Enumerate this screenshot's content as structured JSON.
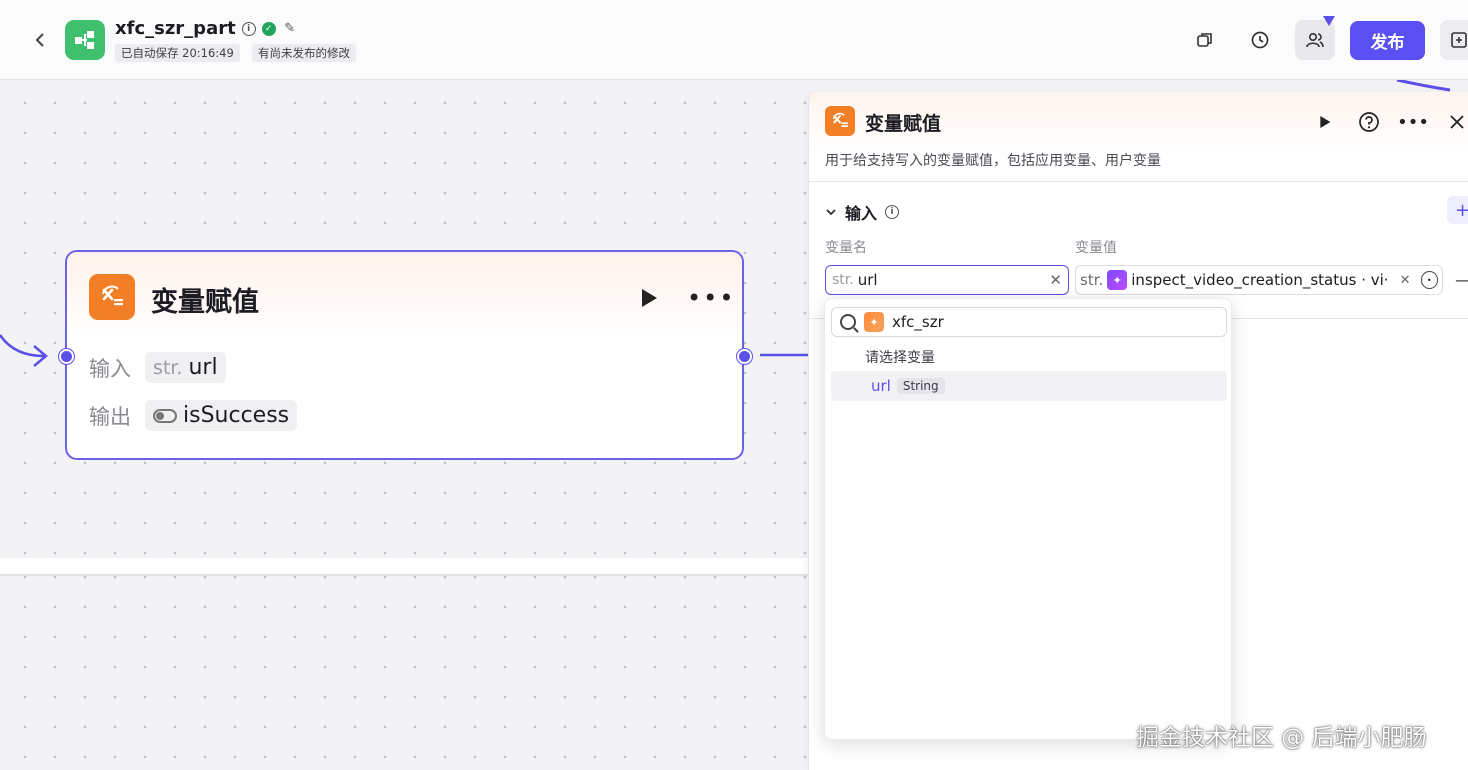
{
  "header": {
    "app_name": "xfc_szr_part",
    "autosave_tag": "已自动保存 20:16:49",
    "unpublished_tag": "有尚未发布的修改",
    "publish_label": "发布"
  },
  "node": {
    "title": "变量赋值",
    "input_label": "输入",
    "input_type": "str.",
    "input_value": "url",
    "output_label": "输出",
    "output_value": "isSuccess"
  },
  "panel": {
    "title": "变量赋值",
    "description": "用于给支持写入的变量赋值，包括应用变量、用户变量",
    "section_title": "输入",
    "col_name": "变量名",
    "col_value": "变量值",
    "name_type": "str.",
    "name_value": "url",
    "value_type": "str.",
    "value_text": "inspect_video_creation_status · vi···"
  },
  "dropdown": {
    "search_value": "xfc_szr",
    "label": "请选择变量",
    "items": [
      {
        "name": "url",
        "type": "String"
      }
    ]
  },
  "watermark": "掘金技术社区 @ 后端小肥肠",
  "colors": {
    "accent": "#5a4ff0",
    "node_icon": "#f27f25",
    "app_icon": "#3ec06e"
  },
  "icons": [
    "back-icon",
    "info-icon",
    "verified-icon",
    "edit-icon",
    "copy-icon",
    "history-icon",
    "users-icon",
    "run-icon",
    "help-icon",
    "more-icon",
    "close-icon",
    "search-icon"
  ]
}
